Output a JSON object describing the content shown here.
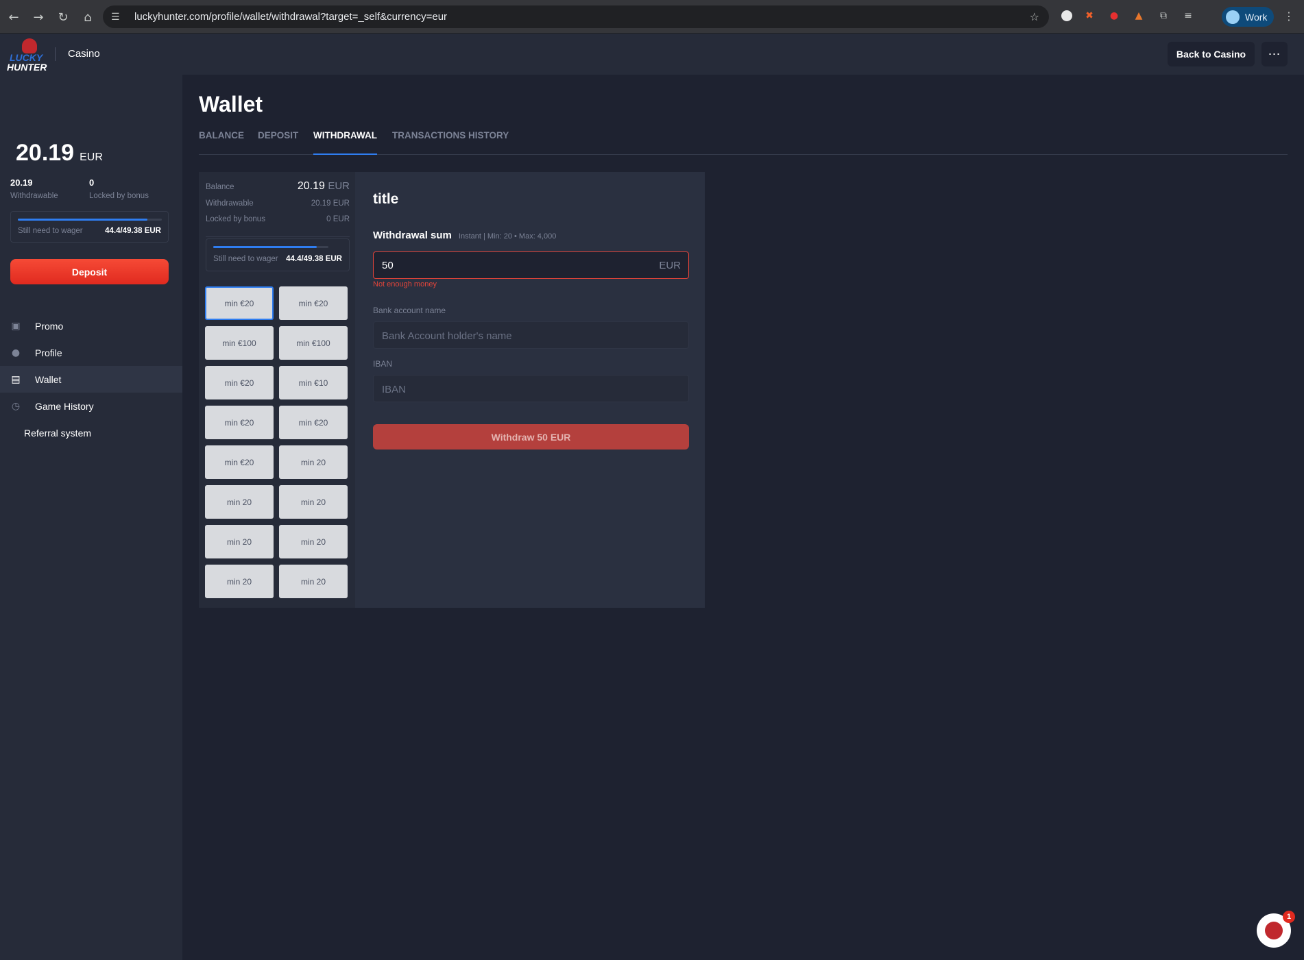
{
  "browser": {
    "url": "luckyhunter.com/profile/wallet/withdrawal?target=_self&currency=eur",
    "profile_name": "Work"
  },
  "header": {
    "logo_top": "LUCKY",
    "logo_bottom": "HUNTER",
    "section": "Casino",
    "back_button": "Back to Casino",
    "more_button": "⋯"
  },
  "sidebar": {
    "balance_amount": "20.19",
    "balance_currency": "EUR",
    "withdrawable_value": "20.19",
    "withdrawable_label": "Withdrawable",
    "locked_value": "0",
    "locked_label": "Locked by bonus",
    "wager_label": "Still need to wager",
    "wager_value": "44.4/49.38 EUR",
    "wager_progress": 0.9,
    "deposit_button": "Deposit",
    "menu": [
      {
        "label": "Promo",
        "icon": "gift-icon"
      },
      {
        "label": "Profile",
        "icon": "user-icon"
      },
      {
        "label": "Wallet",
        "icon": "wallet-icon",
        "active": true
      },
      {
        "label": "Game History",
        "icon": "clock-icon"
      },
      {
        "label": "Referral system",
        "icon": ""
      }
    ]
  },
  "main": {
    "title": "Wallet",
    "tabs": [
      "BALANCE",
      "DEPOSIT",
      "WITHDRAWAL",
      "TRANSACTIONS HISTORY"
    ],
    "active_tab": "WITHDRAWAL"
  },
  "summary": {
    "balance_label": "Balance",
    "balance_value": "20.19",
    "balance_unit": "EUR",
    "withdrawable_label": "Withdrawable",
    "withdrawable_value": "20.19 EUR",
    "locked_label": "Locked by bonus",
    "locked_value": "0 EUR",
    "wager_label": "Still need to wager",
    "wager_value": "44.4/49.38 EUR",
    "wager_progress": 0.9
  },
  "methods": [
    "min €20",
    "min €20",
    "min €100",
    "min €100",
    "min €20",
    "min €10",
    "min €20",
    "min €20",
    "min €20",
    "min 20",
    "min 20",
    "min 20",
    "min 20",
    "min 20",
    "min 20",
    "min 20"
  ],
  "form": {
    "title": "title",
    "sum_label": "Withdrawal sum",
    "sum_hint": "Instant | Min: 20 • Max: 4,000",
    "amount_value": "50",
    "amount_currency": "EUR",
    "error": "Not enough money",
    "bank_label": "Bank account name",
    "bank_placeholder": "Bank Account holder's name",
    "iban_label": "IBAN",
    "iban_placeholder": "IBAN",
    "submit": "Withdraw 50 EUR"
  },
  "chat": {
    "badge": "1"
  },
  "colors": {
    "accent": "#2f7df0",
    "deposit": "#f64a36",
    "error": "#e2443a",
    "background": "#1e2230"
  }
}
